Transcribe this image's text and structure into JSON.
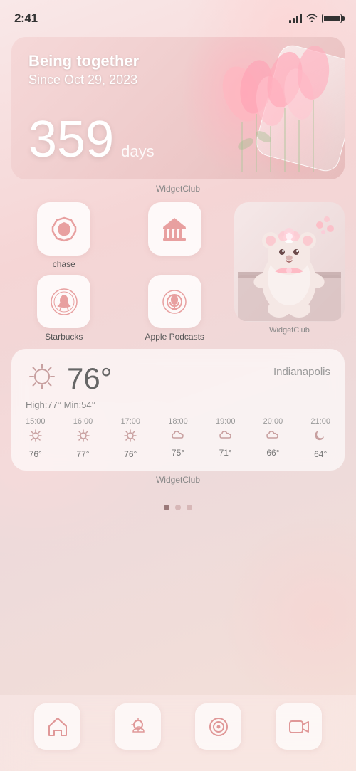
{
  "statusBar": {
    "time": "2:41",
    "batteryFull": true
  },
  "relationshipWidget": {
    "title": "Being together",
    "subtitle": "Since Oct 29, 2023",
    "days": "359",
    "daysLabel": "days",
    "widgetclubLabel": "WidgetClub"
  },
  "appGrid": {
    "apps": [
      {
        "id": "chase",
        "label": "chase"
      },
      {
        "id": "library",
        "label": ""
      },
      {
        "id": "starbucks",
        "label": "Starbucks"
      },
      {
        "id": "podcasts",
        "label": "Apple Podcasts"
      }
    ],
    "widgetclubLabel": "WidgetClub"
  },
  "weather": {
    "city": "Indianapolis",
    "temperature": "76°",
    "high": "77°",
    "min": "54°",
    "detail": "High:77° Min:54°",
    "widgetclubLabel": "WidgetClub",
    "hourly": [
      {
        "time": "15:00",
        "icon": "☀",
        "temp": "76°"
      },
      {
        "time": "16:00",
        "icon": "☀",
        "temp": "77°"
      },
      {
        "time": "17:00",
        "icon": "☀",
        "temp": "76°"
      },
      {
        "time": "18:00",
        "icon": "☁",
        "temp": "75°"
      },
      {
        "time": "19:00",
        "icon": "☁",
        "temp": "71°"
      },
      {
        "time": "20:00",
        "icon": "☁",
        "temp": "66°"
      },
      {
        "time": "21:00",
        "icon": "🌙",
        "temp": "64°"
      }
    ]
  },
  "dock": {
    "icons": [
      {
        "id": "home",
        "label": "Home"
      },
      {
        "id": "weather",
        "label": "Weather"
      },
      {
        "id": "target",
        "label": "Target"
      },
      {
        "id": "video",
        "label": "Video"
      }
    ]
  },
  "pageDots": {
    "total": 3,
    "active": 0
  }
}
